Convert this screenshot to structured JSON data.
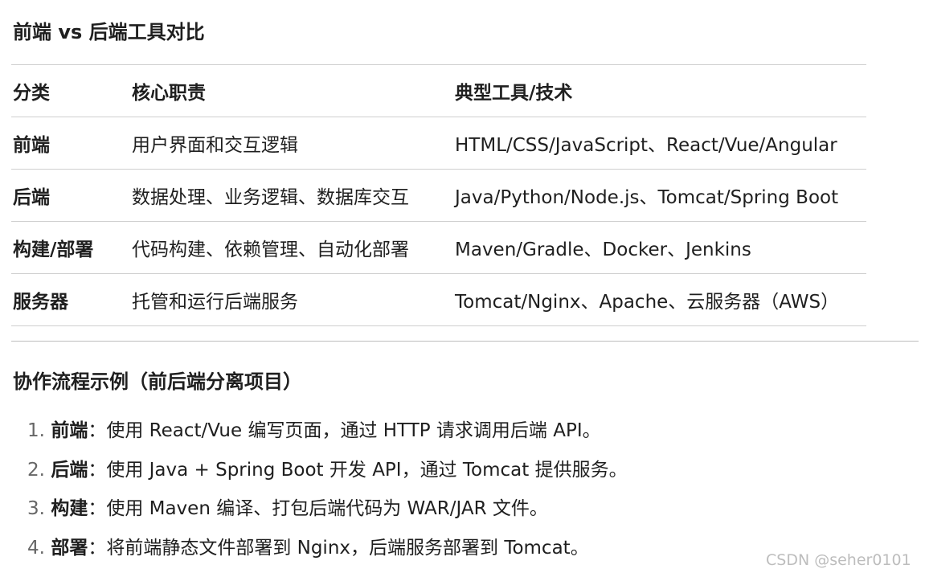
{
  "section1": {
    "title": "前端 vs 后端工具对比",
    "table": {
      "headers": [
        "分类",
        "核心职责",
        "典型工具/技术"
      ],
      "rows": [
        [
          "前端",
          "用户界面和交互逻辑",
          "HTML/CSS/JavaScript、React/Vue/Angular"
        ],
        [
          "后端",
          "数据处理、业务逻辑、数据库交互",
          "Java/Python/Node.js、Tomcat/Spring Boot"
        ],
        [
          "构建/部署",
          "代码构建、依赖管理、自动化部署",
          "Maven/Gradle、Docker、Jenkins"
        ],
        [
          "服务器",
          "托管和运行后端服务",
          "Tomcat/Nginx、Apache、云服务器（AWS）"
        ]
      ]
    }
  },
  "section2": {
    "title": "协作流程示例（前后端分离项目）",
    "steps": [
      {
        "num": "1.",
        "term": "前端",
        "text": "：使用 React/Vue 编写页面，通过 HTTP 请求调用后端 API。"
      },
      {
        "num": "2.",
        "term": "后端",
        "text": "：使用 Java + Spring Boot 开发 API，通过 Tomcat 提供服务。"
      },
      {
        "num": "3.",
        "term": "构建",
        "text": "：使用 Maven 编译、打包后端代码为 WAR/JAR 文件。"
      },
      {
        "num": "4.",
        "term": "部署",
        "text": "：将前端静态文件部署到 Nginx，后端服务部署到 Tomcat。"
      }
    ]
  },
  "watermark": "CSDN @seher0101"
}
